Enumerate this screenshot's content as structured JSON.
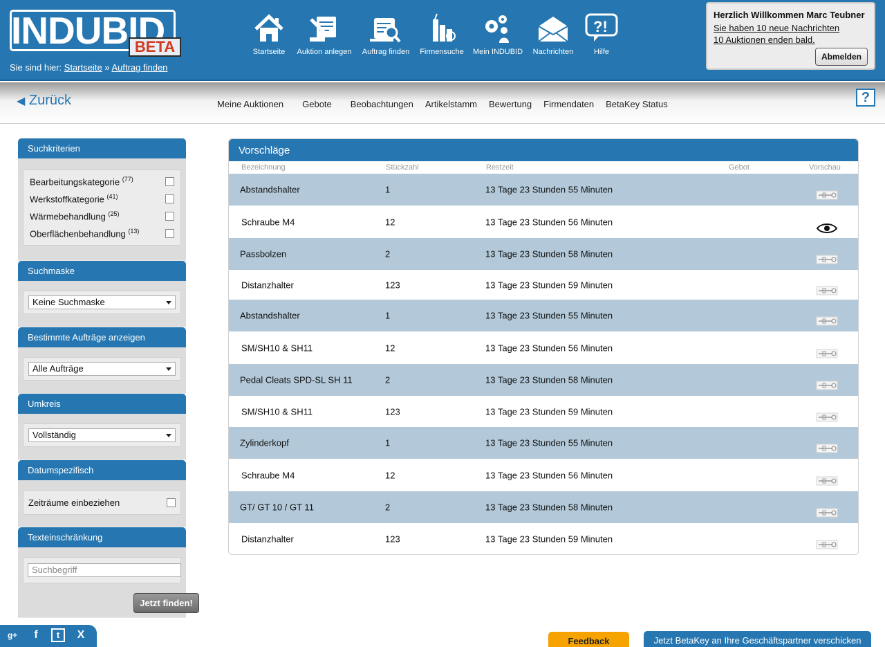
{
  "logo": {
    "text": "INDUBID",
    "badge": "BETA"
  },
  "breadcrumb": {
    "prefix": "Sie sind hier:",
    "home": "Startseite",
    "sep": "»",
    "current": "Auftrag finden"
  },
  "nav": [
    {
      "label": "Startseite",
      "icon": "home-icon"
    },
    {
      "label": "Auktion anlegen",
      "icon": "create-auction-icon"
    },
    {
      "label": "Auftrag finden",
      "icon": "search-order-icon"
    },
    {
      "label": "Firmensuche",
      "icon": "company-search-icon"
    },
    {
      "label": "Mein INDUBID",
      "icon": "settings-user-icon"
    },
    {
      "label": "Nachrichten",
      "icon": "envelope-icon"
    },
    {
      "label": "Hilfe",
      "icon": "help-bubble-icon"
    }
  ],
  "welcome": {
    "title": "Herzlich Willkommen Marc Teubner",
    "messages": "Sie haben  10  neue Nachrichten",
    "auctions": " 10 Auktionen enden bald.",
    "logout": "Abmelden"
  },
  "subnav": {
    "back": "Zurück",
    "help": "?",
    "tabs": [
      "Meine Auktionen",
      "Gebote",
      "Beobachtungen",
      "Artikelstamm",
      "Bewertung",
      "Firmendaten",
      "BetaKey Status"
    ]
  },
  "sidebar": {
    "criteria": {
      "title": "Suchkriterien",
      "items": [
        {
          "label": "Bearbeitungskategorie",
          "count": "(77)"
        },
        {
          "label": "Werkstoffkategorie",
          "count": "(41)"
        },
        {
          "label": "Wärmebehandlung",
          "count": "(25)"
        },
        {
          "label": "Oberflächenbehandlung",
          "count": "(13)"
        }
      ]
    },
    "mask": {
      "title": "Suchmaske",
      "value": "Keine Suchmaske"
    },
    "orders": {
      "title": "Bestimmte Aufträge anzeigen",
      "value": "Alle Aufträge"
    },
    "radius": {
      "title": "Umkreis",
      "value": "Vollständig"
    },
    "date": {
      "title": "Datumspezifisch",
      "label": "Zeiträume einbeziehen"
    },
    "text": {
      "title": "Texteinschränkung",
      "placeholder": "Suchbegriff",
      "button": "Jetzt finden!"
    }
  },
  "table": {
    "title": "Vorschläge",
    "columns": {
      "name": "Bezeichnung",
      "qty": "Stückzahl",
      "time": "Restzeit",
      "bid": "Gebot",
      "preview": "Vorschau"
    },
    "rows": [
      {
        "name": "Abstandshalter",
        "qty": "1",
        "time": "13 Tage 23 Stunden 55 Minuten",
        "preview": "part-thumbnail-icon"
      },
      {
        "name": "Schraube M4",
        "qty": "12",
        "time": "13 Tage 23 Stunden 56 Minuten",
        "preview": "eye-icon"
      },
      {
        "name": "Passbolzen",
        "qty": "2",
        "time": "13 Tage 23 Stunden 58 Minuten",
        "preview": "part-thumbnail-icon"
      },
      {
        "name": "Distanzhalter",
        "qty": "123",
        "time": "13 Tage 23 Stunden 59 Minuten",
        "preview": "part-thumbnail-icon"
      },
      {
        "name": "Abstandshalter",
        "qty": "1",
        "time": "13 Tage 23 Stunden 55 Minuten",
        "preview": "part-thumbnail-icon"
      },
      {
        "name": "SM/SH10 & SH11",
        "qty": "12",
        "time": "13 Tage 23 Stunden 56 Minuten",
        "preview": "part-thumbnail-icon"
      },
      {
        "name": "Pedal Cleats SPD-SL SH 11",
        "qty": "2",
        "time": "13 Tage 23 Stunden 58 Minuten",
        "preview": "part-thumbnail-icon"
      },
      {
        "name": "SM/SH10 & SH11",
        "qty": "123",
        "time": "13 Tage 23 Stunden 59 Minuten",
        "preview": "part-thumbnail-icon"
      },
      {
        "name": "Zylinderkopf",
        "qty": "1",
        "time": "13 Tage 23 Stunden 55 Minuten",
        "preview": "part-thumbnail-icon"
      },
      {
        "name": "Schraube M4",
        "qty": "12",
        "time": "13 Tage 23 Stunden 56 Minuten",
        "preview": "part-thumbnail-icon"
      },
      {
        "name": "GT/ GT 10 / GT 11",
        "qty": "2",
        "time": "13 Tage 23 Stunden 58 Minuten",
        "preview": "part-thumbnail-icon"
      },
      {
        "name": "Distanzhalter",
        "qty": "123",
        "time": "13 Tage 23 Stunden 59 Minuten",
        "preview": "part-thumbnail-icon"
      }
    ]
  },
  "footer": {
    "social": [
      "g+",
      "f",
      "t",
      "X"
    ],
    "feedback": "Feedback",
    "betakey": "Jetzt BetaKey an Ihre Geschäftspartner verschicken"
  },
  "colors": {
    "brand_blue": "#2677b1",
    "row_alt": "#b3c9d9",
    "feedback_orange": "#f6a300",
    "beta_red": "#d23a20"
  }
}
